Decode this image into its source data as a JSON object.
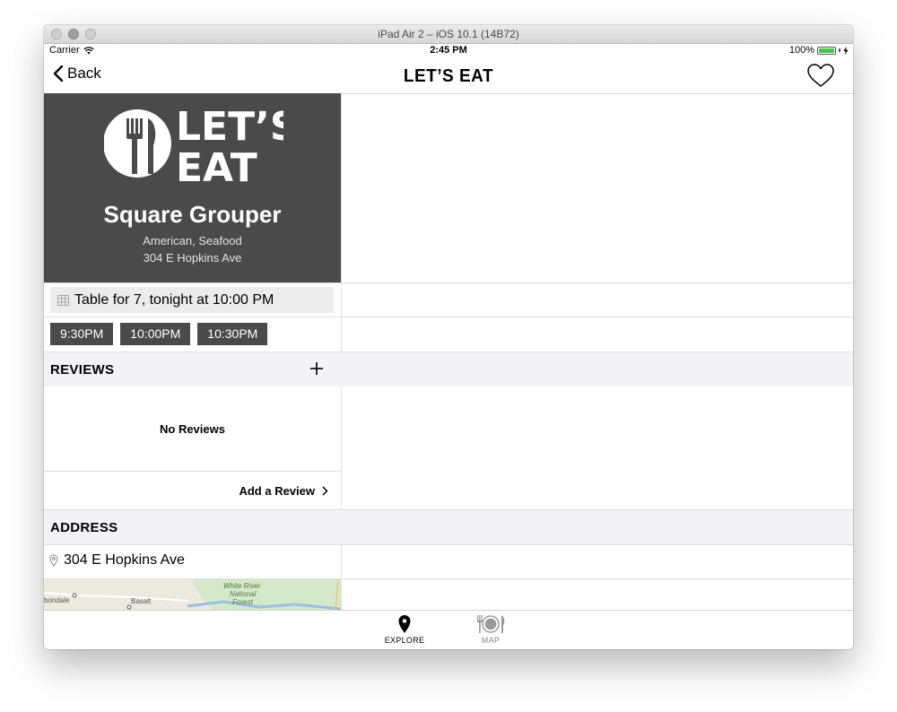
{
  "window": {
    "title": "iPad Air 2 – iOS 10.1 (14B72)"
  },
  "status_bar": {
    "carrier": "Carrier",
    "time": "2:45 PM",
    "battery": "100%"
  },
  "nav": {
    "back_label": "Back",
    "title": "LET’S EAT"
  },
  "restaurant": {
    "logo_text_1": "LET’S",
    "logo_text_2": "EAT",
    "name": "Square Grouper",
    "cuisine": "American, Seafood",
    "address": "304 E Hopkins Ave"
  },
  "reservation": {
    "summary": "Table for 7, tonight at 10:00 PM",
    "time_slots": [
      "9:30PM",
      "10:00PM",
      "10:30PM"
    ]
  },
  "reviews": {
    "heading": "REVIEWS",
    "empty_text": "No Reviews",
    "add_label": "Add a Review"
  },
  "address_section": {
    "heading": "ADDRESS",
    "address": "304 E Hopkins Ave"
  },
  "map": {
    "labels": [
      "bondale",
      "Basalt",
      "White River",
      "National",
      "Forest"
    ]
  },
  "tabs": [
    {
      "label": "EXPLORE",
      "icon": "location-pin-icon",
      "active": true
    },
    {
      "label": "MAP",
      "icon": "plate-cutlery-icon",
      "active": false
    }
  ],
  "colors": {
    "hero_bg": "#4a4a4a",
    "slot_bg": "#4a4a4a",
    "section_bg": "#f3f3f5",
    "battery": "#44c845"
  }
}
